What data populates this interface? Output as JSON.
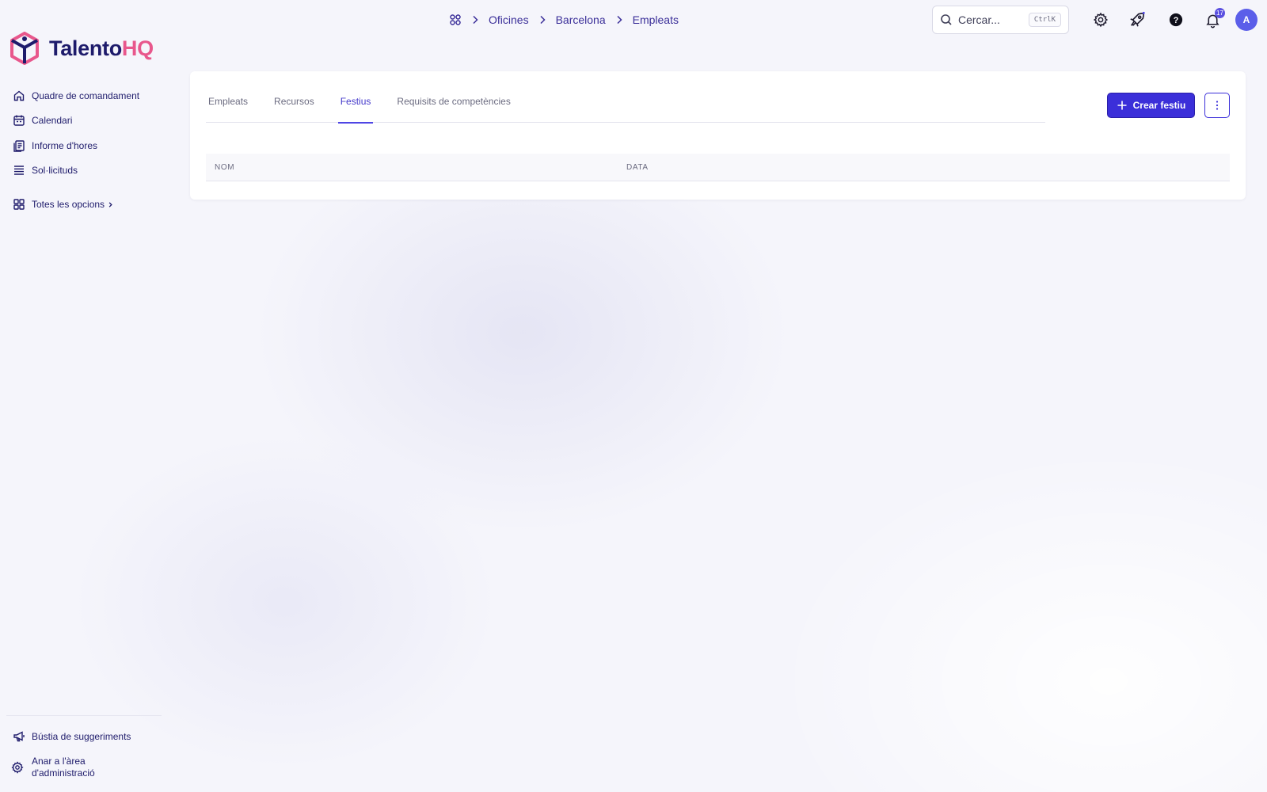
{
  "breadcrumb": {
    "items": [
      "Oficines",
      "Barcelona",
      "Empleats"
    ]
  },
  "search": {
    "placeholder": "Cercar...",
    "shortcut": "CtrlK"
  },
  "notifications": {
    "count": "17"
  },
  "user": {
    "initial": "A"
  },
  "brand": {
    "name_part1": "Talento",
    "name_part2": "HQ",
    "colors": {
      "primary": "#1e1b6b",
      "accent": "#e8578c",
      "button": "#3b2fd9"
    }
  },
  "sidebar": {
    "items": [
      {
        "label": "Quadre de comandament",
        "icon": "home-icon"
      },
      {
        "label": "Calendari",
        "icon": "calendar-icon"
      },
      {
        "label": "Informe d'hores",
        "icon": "timesheet-icon"
      },
      {
        "label": "Sol·licituds",
        "icon": "list-icon"
      }
    ],
    "all_options": "Totes les opcions",
    "footer": [
      {
        "label": "Bústia de suggeriments",
        "icon": "megaphone-icon"
      },
      {
        "label_line1": "Anar a l'àrea",
        "label_line2": "d'administració",
        "icon": "gear-icon"
      }
    ]
  },
  "tabs": [
    {
      "label": "Empleats",
      "active": false
    },
    {
      "label": "Recursos",
      "active": false
    },
    {
      "label": "Festius",
      "active": true
    },
    {
      "label": "Requisits de competències",
      "active": false
    }
  ],
  "actions": {
    "create_label": "Crear festiu"
  },
  "table": {
    "columns": [
      "NOM",
      "DATA"
    ],
    "rows": []
  }
}
